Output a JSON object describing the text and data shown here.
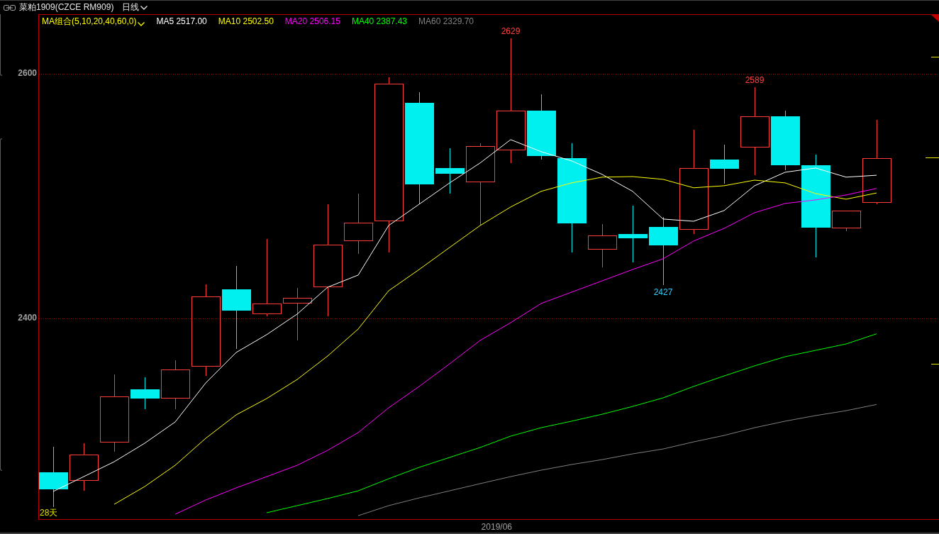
{
  "title_bar": {
    "symbol": "菜粕1909(CZCE RM909)",
    "period": "日线"
  },
  "indicator": {
    "label": "MA组合(5,10,20,40,60,0)",
    "ma_values": [
      "2517.00",
      "2502.50",
      "2506.15",
      "2387.43",
      "2329.70"
    ]
  },
  "chart": {
    "day_count": "28天",
    "date_label": "2019/06",
    "chart_data": {
      "type": "line",
      "ylim": [
        2236,
        2648
      ],
      "yticks": [
        {
          "value": 2400,
          "label": "2400"
        },
        {
          "value": 2600,
          "label": "2600"
        }
      ],
      "series": [
        {
          "name": "MA5",
          "color": "#ffffff",
          "values": [
            2258.6,
            2270.7,
            2282.9,
            2298,
            2315.4,
            2347.2,
            2372.2,
            2386.7,
            2403.5,
            2425.5,
            2435.4,
            2475.9,
            2493.3,
            2510.7,
            2527,
            2546.1,
            2536.2,
            2528.7,
            2517.7,
            2503.8,
            2481.2,
            2479.4,
            2488.1,
            2508.4,
            2519.4,
            2522.9,
            2515.4,
            2517.0
          ]
        },
        {
          "name": "MA10",
          "color": "#ffff00",
          "values": [
            null,
            null,
            2248.1,
            2262.6,
            2280,
            2302,
            2321.2,
            2334.5,
            2350.1,
            2369.3,
            2391.3,
            2422.6,
            2440,
            2458,
            2475.9,
            2491,
            2503.8,
            2510.7,
            2515.4,
            2515.9,
            2513.6,
            2506.7,
            2508.4,
            2513,
            2510.7,
            2502,
            2497.4,
            2502.5
          ]
        },
        {
          "name": "MA20",
          "color": "#ff00ff",
          "values": [
            null,
            null,
            null,
            null,
            2240,
            2251.6,
            2261.5,
            2270.7,
            2280,
            2292.2,
            2306.7,
            2327,
            2344.4,
            2362.9,
            2382,
            2396.5,
            2412.2,
            2421.5,
            2430.7,
            2440,
            2448.7,
            2463.2,
            2473.6,
            2486.4,
            2493.9,
            2496.8,
            2500.9,
            2506.2
          ]
        },
        {
          "name": "MA40",
          "color": "#00ff00",
          "values": [
            null,
            null,
            null,
            null,
            null,
            null,
            null,
            2241.2,
            2247,
            2252.8,
            2259.1,
            2269,
            2278.3,
            2286.4,
            2294.5,
            2303.8,
            2310.7,
            2316,
            2321.7,
            2328.1,
            2335.1,
            2344.4,
            2353,
            2361.2,
            2368.7,
            2373.9,
            2379.1,
            2387.4
          ]
        },
        {
          "name": "MA60",
          "color": "#808080",
          "values": [
            null,
            null,
            null,
            null,
            null,
            null,
            null,
            null,
            null,
            null,
            2238.8,
            2247,
            2253.3,
            2259.1,
            2265,
            2270.7,
            2276,
            2280.6,
            2284.6,
            2289.3,
            2293.3,
            2299.1,
            2304.4,
            2310.7,
            2316,
            2320.6,
            2324.6,
            2329.7
          ]
        }
      ],
      "annotations": [
        "2629",
        "2589",
        "2427"
      ]
    }
  }
}
